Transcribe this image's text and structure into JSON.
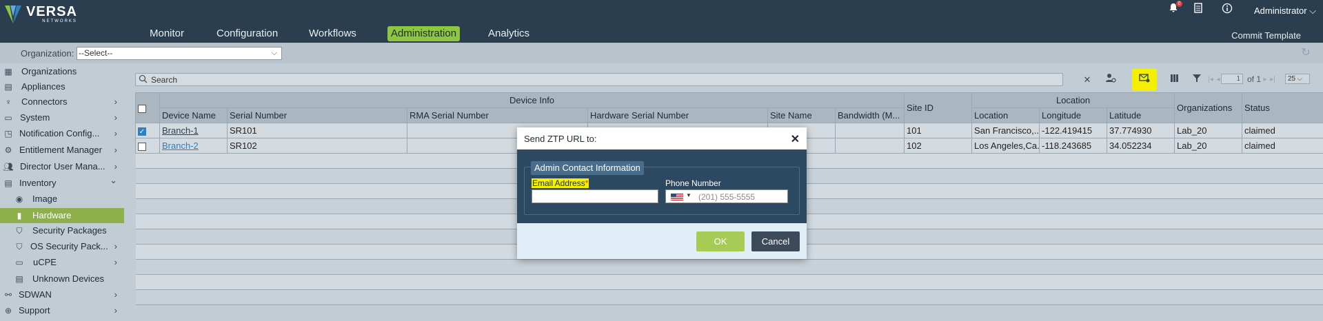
{
  "header": {
    "logo_name": "VERSA",
    "logo_sub": "NETWORKS",
    "nav": [
      "Monitor",
      "Configuration",
      "Workflows",
      "Administration",
      "Analytics"
    ],
    "active_nav": "Administration",
    "notification_count": "0",
    "user": "Administrator",
    "commit_label": "Commit Template",
    "colors": {
      "header_bg": "#2b3e50",
      "accent": "#8fc63f"
    }
  },
  "orgbar": {
    "label": "Organization:",
    "selected": "--Select--"
  },
  "sidebar": {
    "items": [
      {
        "label": "Organizations",
        "icon": "org-icon"
      },
      {
        "label": "Appliances",
        "icon": "appliances-icon"
      },
      {
        "label": "Connectors",
        "icon": "connectors-icon",
        "arrow": "›"
      },
      {
        "label": "System",
        "icon": "system-icon",
        "arrow": "›"
      },
      {
        "label": "Notification Config...",
        "icon": "notification-config-icon",
        "arrow": "›"
      },
      {
        "label": "Entitlement Manager",
        "icon": "gear-icon",
        "arrow": "›"
      },
      {
        "label": "Director User Mana...",
        "icon": "users-icon",
        "arrow": "›"
      },
      {
        "label": "Inventory",
        "icon": "inventory-icon",
        "arrow": "⌄"
      },
      {
        "label": "Image",
        "icon": "image-icon"
      },
      {
        "label": "Hardware",
        "icon": "hardware-icon"
      },
      {
        "label": "Security Packages",
        "icon": "shield-icon"
      },
      {
        "label": "OS Security Pack...",
        "icon": "shield-icon",
        "arrow": "›"
      },
      {
        "label": "uCPE",
        "icon": "ucpe-icon",
        "arrow": "›"
      },
      {
        "label": "Unknown Devices",
        "icon": "unknown-devices-icon"
      },
      {
        "label": "SDWAN",
        "icon": "sdwan-icon",
        "arrow": "›"
      },
      {
        "label": "Support",
        "icon": "support-icon",
        "arrow": "›"
      }
    ],
    "active": "Hardware"
  },
  "toolbar": {
    "search_placeholder": "Search",
    "page_current": "1",
    "page_of": "of 1",
    "page_size": "25"
  },
  "table": {
    "group_headers": {
      "device_info": "Device Info",
      "location": "Location"
    },
    "columns": [
      "Device Name",
      "Serial Number",
      "RMA Serial Number",
      "Hardware Serial Number",
      "Site Name",
      "Bandwidth (M...",
      "Site ID",
      "Location",
      "Longitude",
      "Latitude",
      "Organizations",
      "Status"
    ],
    "rows": [
      {
        "checked": true,
        "device_name": "Branch-1",
        "serial": "SR101",
        "rma": "",
        "hw_serial": "",
        "site_name": "",
        "bandwidth": "",
        "site_id": "101",
        "location": "San Francisco,...",
        "longitude": "-122.419415",
        "latitude": "37.774930",
        "org": "Lab_20",
        "status": "claimed"
      },
      {
        "checked": false,
        "device_name": "Branch-2",
        "serial": "SR102",
        "rma": "",
        "hw_serial": "",
        "site_name": "",
        "bandwidth": "",
        "site_id": "102",
        "location": "Los Angeles,Ca...",
        "longitude": "-118.243685",
        "latitude": "34.052234",
        "org": "Lab_20",
        "status": "claimed"
      }
    ]
  },
  "modal": {
    "title": "Send ZTP URL to:",
    "section": "Admin Contact Information",
    "email_label": "Email Address",
    "email_required": "*",
    "email_value": "",
    "phone_label": "Phone Number",
    "phone_placeholder": "(201) 555-5555",
    "ok": "OK",
    "cancel": "Cancel"
  }
}
